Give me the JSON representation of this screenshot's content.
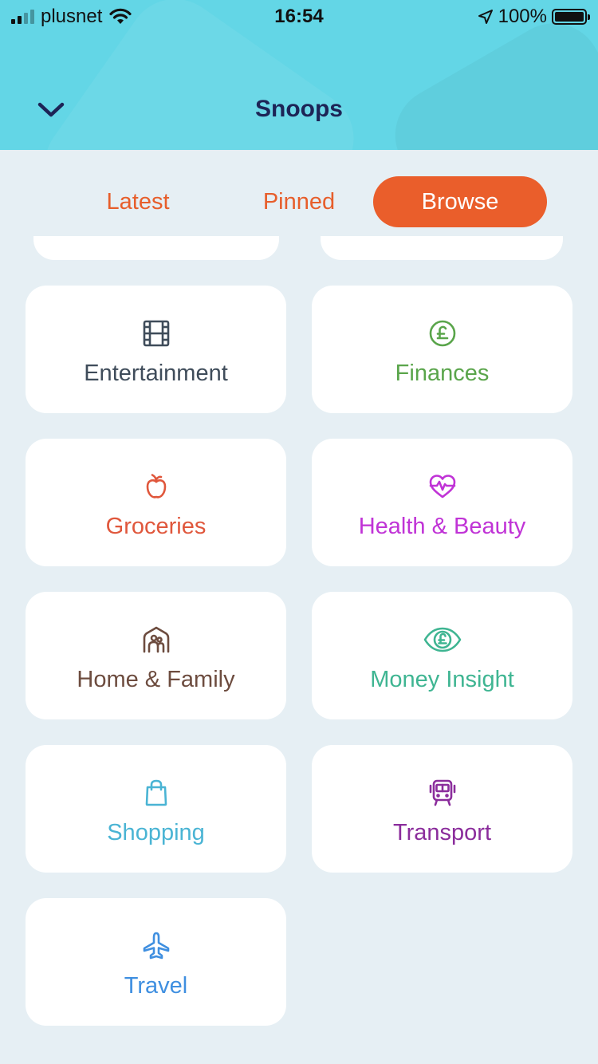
{
  "status_bar": {
    "carrier": "plusnet",
    "time": "16:54",
    "battery": "100%"
  },
  "header": {
    "title": "Snoops",
    "back_icon": "chevron-down-icon"
  },
  "tabs": [
    {
      "label": "Latest",
      "active": false
    },
    {
      "label": "Pinned",
      "active": false
    },
    {
      "label": "Browse",
      "active": true
    }
  ],
  "categories": [
    {
      "label": "Entertainment",
      "icon": "film-icon",
      "color": "#3f4c5a"
    },
    {
      "label": "Finances",
      "icon": "pound-coin-icon",
      "color": "#5aa54b"
    },
    {
      "label": "Groceries",
      "icon": "apple-icon",
      "color": "#e0573c"
    },
    {
      "label": "Health & Beauty",
      "icon": "heart-pulse-icon",
      "color": "#c033d6"
    },
    {
      "label": "Home & Family",
      "icon": "home-family-icon",
      "color": "#6d4c3f"
    },
    {
      "label": "Money Insight",
      "icon": "eye-pound-icon",
      "color": "#3fb592"
    },
    {
      "label": "Shopping",
      "icon": "shopping-bag-icon",
      "color": "#4ab4d4"
    },
    {
      "label": "Transport",
      "icon": "train-icon",
      "color": "#8b2d9c"
    },
    {
      "label": "Travel",
      "icon": "plane-icon",
      "color": "#3f8fe0"
    }
  ],
  "colors": {
    "header_bg": "#63d6e6",
    "page_bg": "#e6eff4",
    "accent": "#ea5e2b",
    "title": "#1d2456"
  }
}
